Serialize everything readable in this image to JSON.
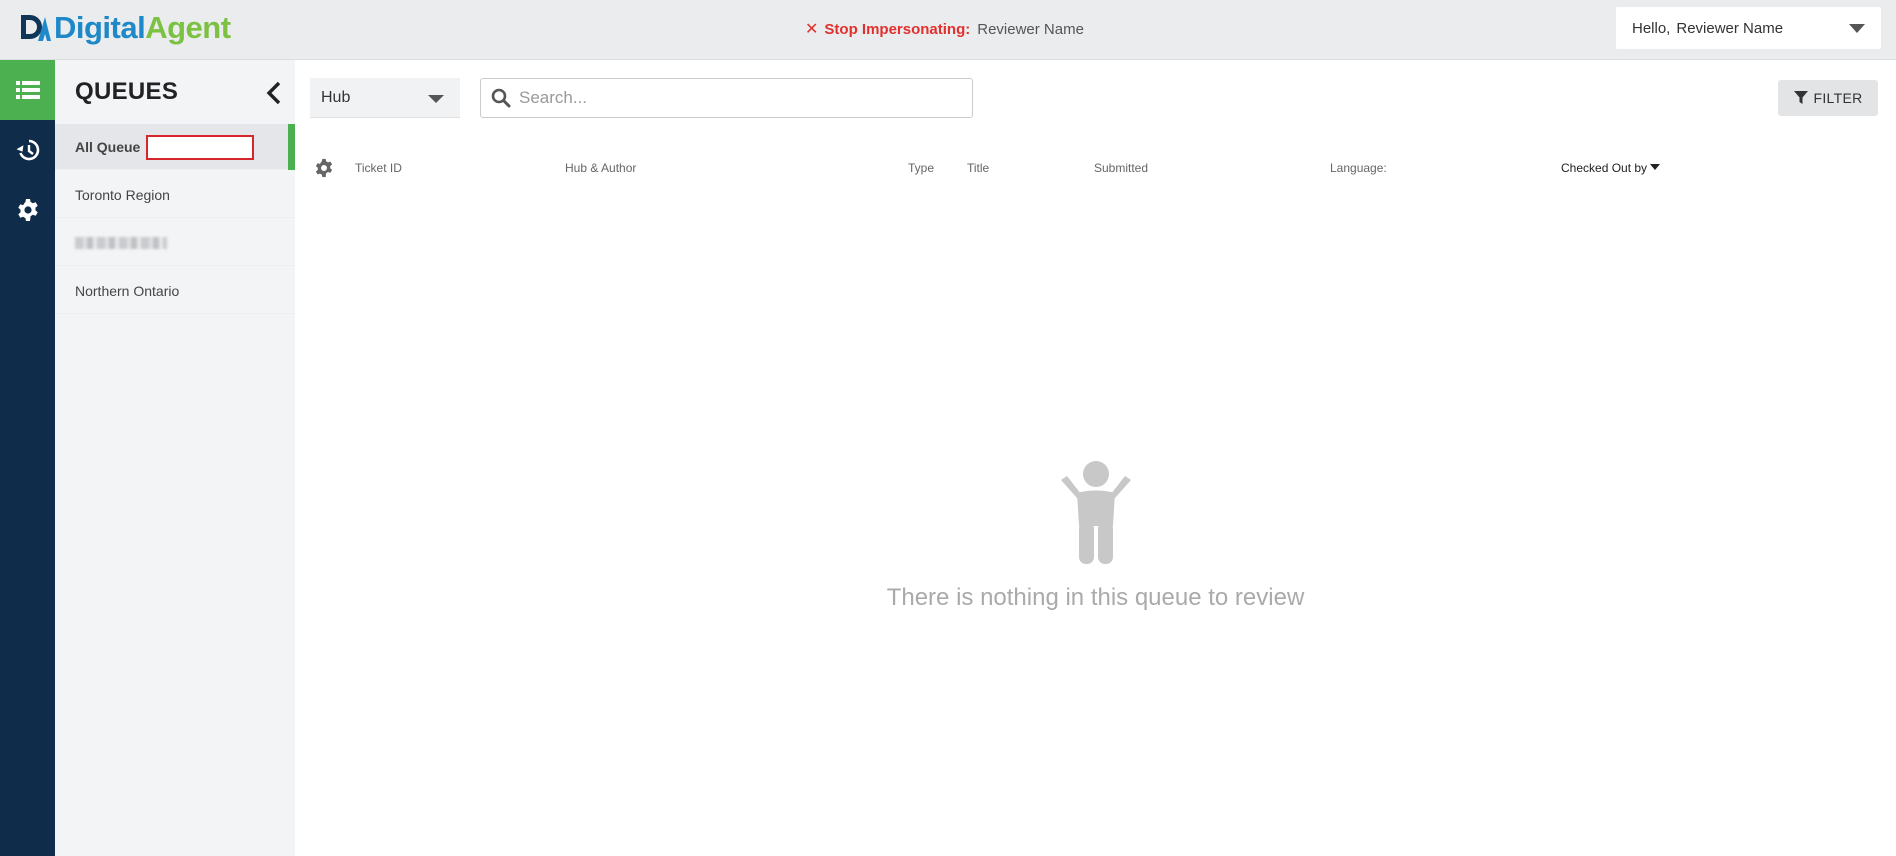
{
  "header": {
    "logo": {
      "text_part1": "Digital",
      "text_part2": "Agent"
    },
    "impersonation": {
      "stop_label": "Stop Impersonating:",
      "user_name": "Reviewer Name"
    },
    "user_menu": {
      "greeting": "Hello,",
      "user_name": "Reviewer Name"
    }
  },
  "rail": {
    "items": [
      {
        "icon": "list-icon",
        "active": true
      },
      {
        "icon": "history-icon",
        "active": false
      },
      {
        "icon": "gear-icon",
        "active": false
      }
    ],
    "active_color": "#4caf50",
    "background": "#0f2c4a"
  },
  "queues": {
    "title": "QUEUES",
    "items": [
      {
        "label": "All Queue",
        "active": true
      },
      {
        "label": "Toronto Region",
        "active": false
      },
      {
        "label": "",
        "active": false,
        "redacted": true
      },
      {
        "label": "Northern Ontario",
        "active": false
      }
    ]
  },
  "toolbar": {
    "hub_select": {
      "selected": "Hub"
    },
    "search": {
      "placeholder": "Search..."
    },
    "filter_label": "FILTER"
  },
  "table": {
    "columns": [
      "Ticket ID",
      "Hub & Author",
      "Type",
      "Title",
      "Submitted",
      "Language:",
      "Checked Out by"
    ],
    "rows": []
  },
  "empty_state": {
    "message": "There is nothing in this queue to review"
  }
}
